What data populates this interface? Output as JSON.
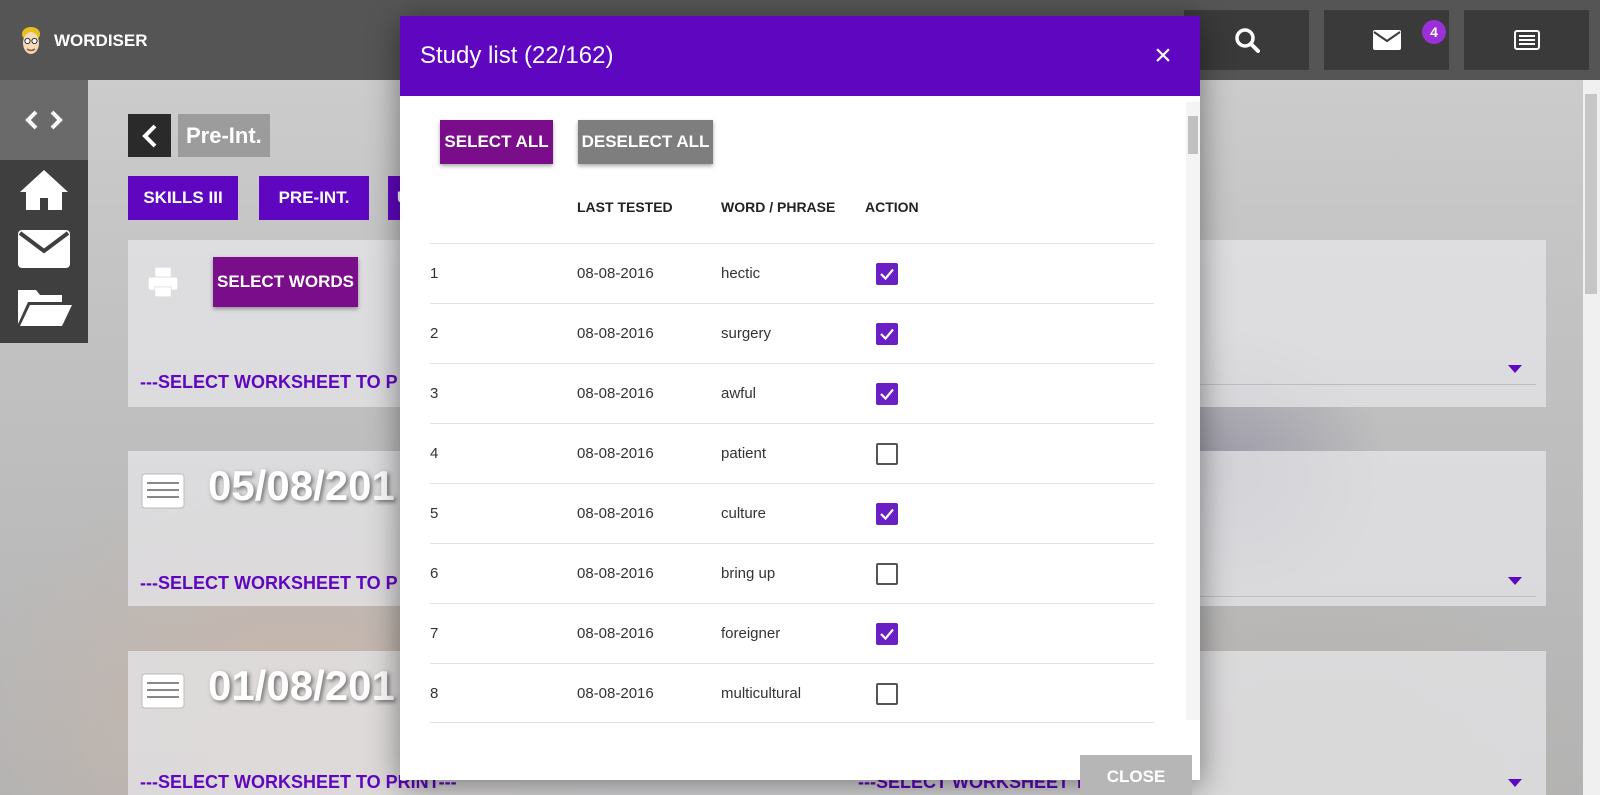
{
  "app": {
    "name": "WORDISER"
  },
  "header": {
    "messages_badge": "4"
  },
  "breadcrumb": {
    "level": "Pre-Int."
  },
  "tabs": [
    "SKILLS III",
    "PRE-INT.",
    "U"
  ],
  "panels": {
    "select_words_label": "SELECT WORDS",
    "ws_placeholder": "---SELECT WORKSHEET TO PRINT---",
    "ws_placeholder_short": "---SELECT WORKSHEET TO P",
    "date1": "05/08/201",
    "date2": "01/08/201"
  },
  "modal": {
    "title": "Study list (22/162)",
    "close_glyph": "×",
    "select_all": "SELECT ALL",
    "deselect_all": "DESELECT ALL",
    "columns": {
      "num": "",
      "last_tested": "LAST TESTED",
      "word": "WORD / PHRASE",
      "action": "ACTION"
    },
    "rows": [
      {
        "num": "1",
        "date": "08-08-2016",
        "word": "hectic",
        "checked": true
      },
      {
        "num": "2",
        "date": "08-08-2016",
        "word": "surgery",
        "checked": true
      },
      {
        "num": "3",
        "date": "08-08-2016",
        "word": "awful",
        "checked": true
      },
      {
        "num": "4",
        "date": "08-08-2016",
        "word": "patient",
        "checked": false
      },
      {
        "num": "5",
        "date": "08-08-2016",
        "word": "culture",
        "checked": true
      },
      {
        "num": "6",
        "date": "08-08-2016",
        "word": "bring up",
        "checked": false
      },
      {
        "num": "7",
        "date": "08-08-2016",
        "word": "foreigner",
        "checked": true
      },
      {
        "num": "8",
        "date": "08-08-2016",
        "word": "multicultural",
        "checked": false
      }
    ],
    "footer_close": "CLOSE"
  },
  "colors": {
    "primary": "#5f06c0",
    "accent": "#7a0d8a",
    "checkbox": "#6a1fc4"
  }
}
